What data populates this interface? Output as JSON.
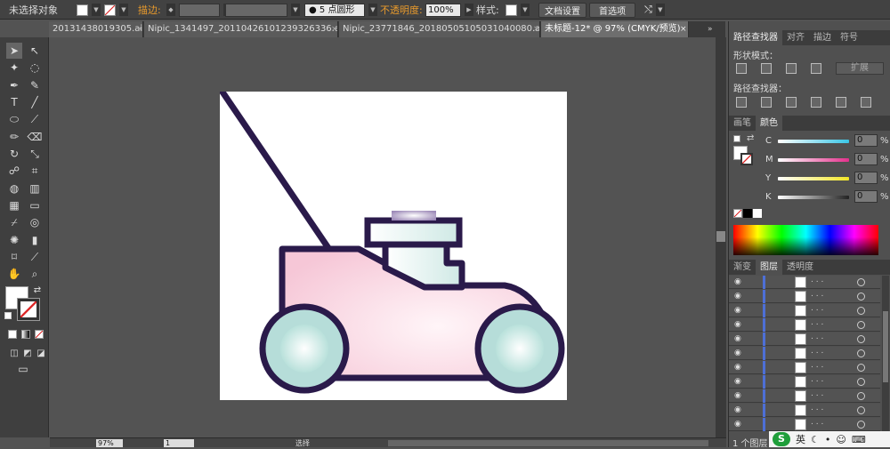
{
  "control_bar": {
    "selection_label": "未选择对象",
    "stroke_label": "描边:",
    "brush_label": "5 点圆形",
    "opacity_label": "不透明度:",
    "opacity_value": "100%",
    "style_label": "样式:",
    "doc_settings": "文档设置",
    "preferences": "首选项"
  },
  "tabs": [
    {
      "label": "20131438019305.ai*",
      "active": false
    },
    {
      "label": "Nipic_1341497_20110426101239326336.ai*",
      "active": false
    },
    {
      "label": "Nipic_23771846_20180505105031040080.ai*",
      "active": false
    },
    {
      "label": "未标题-12* @ 97% (CMYK/预览)",
      "active": true
    }
  ],
  "pathfinder": {
    "tabs": [
      "路径查找器",
      "对齐",
      "描边",
      "符号"
    ],
    "shape_modes_label": "形状模式：",
    "expand_button": "扩展",
    "pathfinders_label": "路径查找器："
  },
  "color_panel": {
    "tabs": [
      "画笔",
      "颜色"
    ],
    "channels": [
      {
        "name": "C",
        "value": "0",
        "unit": "%",
        "color": "#3ac6e6"
      },
      {
        "name": "M",
        "value": "0",
        "unit": "%",
        "color": "#e4308c"
      },
      {
        "name": "Y",
        "value": "0",
        "unit": "%",
        "color": "#f2e626"
      },
      {
        "name": "K",
        "value": "0",
        "unit": "%",
        "color": "#222222"
      }
    ]
  },
  "layers_panel": {
    "tabs": [
      "渐变",
      "图层",
      "透明度"
    ],
    "rows": 11,
    "footer": "1 个图层"
  },
  "status_bar": {
    "zoom": "97%",
    "page": "1",
    "mode": "选择"
  },
  "taskbar": {
    "ime_label": "英"
  },
  "colors": {
    "mower_outline": "#2a1a4a",
    "mower_body": "#f8d6e2",
    "wheel_fill": "#b6ddd9",
    "engine_fill": "#e6f5f3"
  }
}
